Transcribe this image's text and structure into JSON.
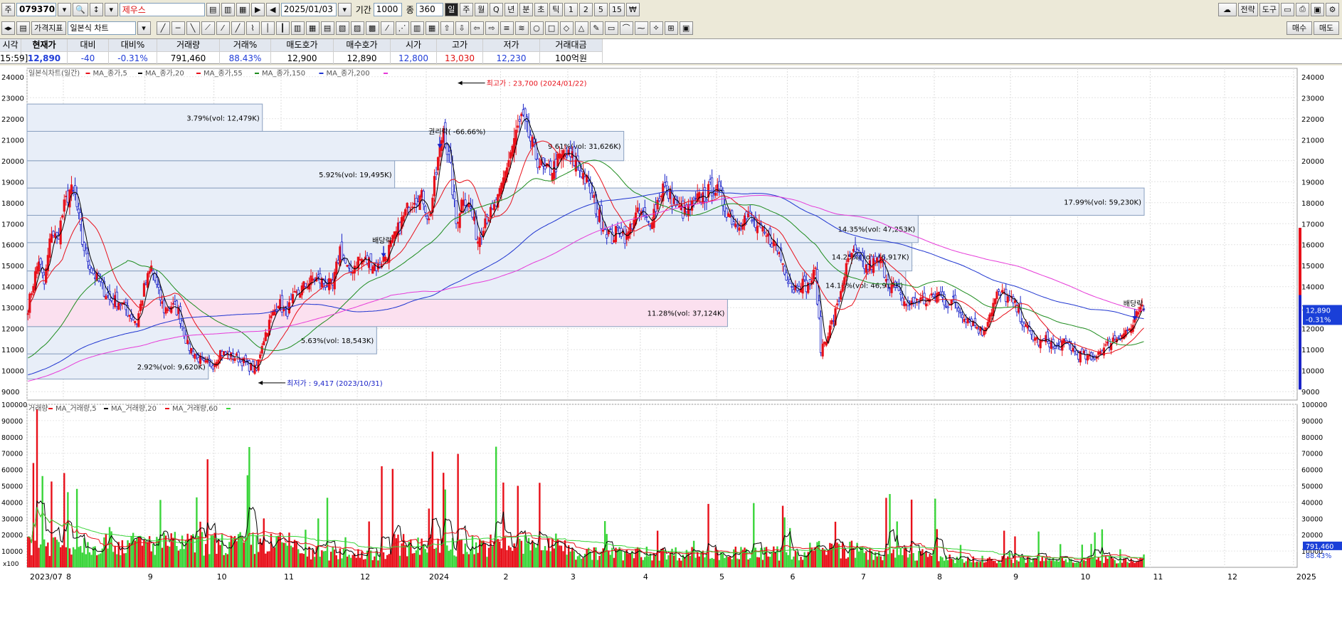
{
  "toolbar": {
    "code_prefix": "주",
    "stock_code": "079370",
    "stock_name": "제우스",
    "date": "2025/01/03",
    "period_label": "기간",
    "period_value": "1000",
    "count_label": "종",
    "count_value": "360",
    "periods": [
      "일",
      "주",
      "월",
      "Q",
      "년",
      "분",
      "초",
      "틱",
      "1",
      "2",
      "5",
      "15",
      "₩"
    ],
    "active_period": "일",
    "right_buttons": [
      "전략",
      "도구"
    ],
    "indicator_label": "가격지표",
    "chart_type": "일본식 차트",
    "buy_label": "매수",
    "sell_label": "매도"
  },
  "quote": {
    "headers": [
      "시각",
      "현재가",
      "대비",
      "대비%",
      "거래량",
      "거래%",
      "매도호가",
      "매수호가",
      "시가",
      "고가",
      "저가",
      "거래대금"
    ],
    "values": [
      "15:59]",
      "12,890",
      "-40",
      "-0.31%",
      "791,460",
      "88.43%",
      "12,900",
      "12,890",
      "12,800",
      "13,030",
      "12,230",
      "100억원"
    ]
  },
  "colors": {
    "up": "#e8101a",
    "down": "#1a23c8",
    "ma5": "#000000",
    "ma20": "#e8101a",
    "ma55": "#1e8c1e",
    "ma150": "#1f35d0",
    "ma200": "#e63ad8",
    "vol_up": "#e8101a",
    "vol_down": "#3ad53a",
    "profile_blue": "#e8eef8",
    "profile_pink": "#fbe0ef"
  },
  "chart_data": {
    "type": "candlestick",
    "legend": [
      {
        "name": "일본식차트(일간)",
        "color": "#e8101a"
      },
      {
        "name": "MA_종가,5",
        "color": "#000000"
      },
      {
        "name": "MA_종가,20",
        "color": "#e8101a"
      },
      {
        "name": "MA_종가,55",
        "color": "#1e8c1e"
      },
      {
        "name": "MA_종가,150",
        "color": "#1f35d0"
      },
      {
        "name": "MA_종가,200",
        "color": "#e63ad8"
      }
    ],
    "volume_legend": [
      {
        "name": "거래량",
        "color": "#e8101a"
      },
      {
        "name": "MA_거래량,5",
        "color": "#000000"
      },
      {
        "name": "MA_거래량,20",
        "color": "#e8101a"
      },
      {
        "name": "MA_거래량,60",
        "color": "#3ad53a"
      }
    ],
    "ylim": [
      8600,
      24400
    ],
    "yticks": [
      9000,
      10000,
      11000,
      12000,
      13000,
      14000,
      15000,
      16000,
      17000,
      18000,
      19000,
      20000,
      21000,
      22000,
      23000,
      24000
    ],
    "vol_ylim": [
      0,
      100000
    ],
    "vol_yticks": [
      10000,
      20000,
      30000,
      40000,
      50000,
      60000,
      70000,
      80000,
      90000,
      100000
    ],
    "vol_unit": "x100",
    "x_ticks": [
      {
        "label": "2023/07",
        "bar": 0
      },
      {
        "label": "8",
        "bar": 20
      },
      {
        "label": "9",
        "bar": 65
      },
      {
        "label": "10",
        "bar": 103
      },
      {
        "label": "11",
        "bar": 140
      },
      {
        "label": "12",
        "bar": 182
      },
      {
        "label": "2024",
        "bar": 220
      },
      {
        "label": "2",
        "bar": 261
      },
      {
        "label": "3",
        "bar": 298
      },
      {
        "label": "4",
        "bar": 338
      },
      {
        "label": "5",
        "bar": 380
      },
      {
        "label": "6",
        "bar": 419
      },
      {
        "label": "7",
        "bar": 458
      },
      {
        "label": "8",
        "bar": 500
      },
      {
        "label": "9",
        "bar": 542
      },
      {
        "label": "10",
        "bar": 579
      },
      {
        "label": "11",
        "bar": 619
      },
      {
        "label": "12",
        "bar": 660
      },
      {
        "label": "2025",
        "bar": 698
      }
    ],
    "n_bars": 700,
    "close_anchors": [
      [
        0,
        13000
      ],
      [
        3,
        14200
      ],
      [
        6,
        15300
      ],
      [
        9,
        14100
      ],
      [
        13,
        16700
      ],
      [
        16,
        16200
      ],
      [
        20,
        17800
      ],
      [
        23,
        18600
      ],
      [
        26,
        18300
      ],
      [
        30,
        16100
      ],
      [
        35,
        14800
      ],
      [
        40,
        14100
      ],
      [
        45,
        13400
      ],
      [
        50,
        13300
      ],
      [
        55,
        12800
      ],
      [
        60,
        12300
      ],
      [
        64,
        13900
      ],
      [
        68,
        14900
      ],
      [
        72,
        13700
      ],
      [
        75,
        12900
      ],
      [
        79,
        13100
      ],
      [
        83,
        12800
      ],
      [
        88,
        11200
      ],
      [
        92,
        10800
      ],
      [
        97,
        10300
      ],
      [
        102,
        10300
      ],
      [
        106,
        10900
      ],
      [
        110,
        10700
      ],
      [
        116,
        10600
      ],
      [
        122,
        10200
      ],
      [
        126,
        10000
      ],
      [
        129,
        11300
      ],
      [
        134,
        12500
      ],
      [
        138,
        13300
      ],
      [
        142,
        12700
      ],
      [
        147,
        13500
      ],
      [
        152,
        14000
      ],
      [
        158,
        14400
      ],
      [
        163,
        14200
      ],
      [
        168,
        14000
      ],
      [
        172,
        15800
      ],
      [
        177,
        14600
      ],
      [
        182,
        15300
      ],
      [
        188,
        15200
      ],
      [
        193,
        14900
      ],
      [
        198,
        15600
      ],
      [
        203,
        16500
      ],
      [
        208,
        17500
      ],
      [
        213,
        18300
      ],
      [
        218,
        18200
      ],
      [
        221,
        17100
      ],
      [
        226,
        20000
      ],
      [
        229,
        21600
      ],
      [
        233,
        19500
      ],
      [
        236,
        17000
      ],
      [
        240,
        18400
      ],
      [
        244,
        17700
      ],
      [
        248,
        16200
      ],
      [
        252,
        17300
      ],
      [
        256,
        17500
      ],
      [
        260,
        18300
      ],
      [
        264,
        19800
      ],
      [
        268,
        21000
      ],
      [
        272,
        22000
      ],
      [
        276,
        21200
      ],
      [
        280,
        20200
      ],
      [
        285,
        19400
      ],
      [
        290,
        19700
      ],
      [
        295,
        20300
      ],
      [
        300,
        20100
      ],
      [
        305,
        19500
      ],
      [
        310,
        18600
      ],
      [
        314,
        17500
      ],
      [
        318,
        16800
      ],
      [
        322,
        16300
      ],
      [
        326,
        16800
      ],
      [
        330,
        16300
      ],
      [
        334,
        17300
      ],
      [
        338,
        17500
      ],
      [
        342,
        17000
      ],
      [
        346,
        17800
      ],
      [
        350,
        18800
      ],
      [
        354,
        18300
      ],
      [
        358,
        17800
      ],
      [
        362,
        17500
      ],
      [
        366,
        17800
      ],
      [
        370,
        18200
      ],
      [
        374,
        18400
      ],
      [
        378,
        18800
      ],
      [
        382,
        18200
      ],
      [
        386,
        17500
      ],
      [
        390,
        17000
      ],
      [
        394,
        17300
      ],
      [
        398,
        17200
      ],
      [
        402,
        16800
      ],
      [
        406,
        16400
      ],
      [
        410,
        16200
      ],
      [
        414,
        15600
      ],
      [
        418,
        14600
      ],
      [
        422,
        13900
      ],
      [
        426,
        14200
      ],
      [
        430,
        14000
      ],
      [
        434,
        14700
      ],
      [
        437,
        11000
      ],
      [
        442,
        12000
      ],
      [
        446,
        13000
      ],
      [
        450,
        14600
      ],
      [
        454,
        15600
      ],
      [
        458,
        15300
      ],
      [
        462,
        14900
      ],
      [
        466,
        15100
      ],
      [
        470,
        15200
      ],
      [
        474,
        14300
      ],
      [
        478,
        13900
      ],
      [
        482,
        13300
      ],
      [
        486,
        13100
      ],
      [
        490,
        13400
      ],
      [
        494,
        13300
      ],
      [
        498,
        13400
      ],
      [
        502,
        13700
      ],
      [
        506,
        13200
      ],
      [
        510,
        13300
      ],
      [
        514,
        12800
      ],
      [
        518,
        12500
      ],
      [
        522,
        12200
      ],
      [
        526,
        11800
      ],
      [
        530,
        12700
      ],
      [
        534,
        13600
      ],
      [
        538,
        13600
      ],
      [
        542,
        13300
      ],
      [
        546,
        12800
      ],
      [
        550,
        12000
      ],
      [
        554,
        11600
      ],
      [
        558,
        11300
      ],
      [
        562,
        11500
      ],
      [
        566,
        11000
      ],
      [
        570,
        11300
      ],
      [
        574,
        11200
      ],
      [
        578,
        10800
      ],
      [
        582,
        10700
      ],
      [
        586,
        10500
      ],
      [
        590,
        10900
      ],
      [
        594,
        11100
      ],
      [
        598,
        11500
      ],
      [
        602,
        11700
      ],
      [
        606,
        11900
      ],
      [
        609,
        12100
      ],
      [
        612,
        12800
      ],
      [
        615,
        12890
      ]
    ],
    "annotations": [
      {
        "text": "최고가 : 23,700 (2024/01/22)",
        "color": "#e8101a",
        "bar": 237,
        "value": 23700
      },
      {
        "text": "최저가 : 9,417 (2023/10/31)",
        "color": "#1a23c8",
        "bar": 127,
        "value": 9417
      },
      {
        "text": "권리락( -66.66%)",
        "color": "#000000",
        "bar": 227,
        "value": 21000
      },
      {
        "text": "배당락",
        "color": "#000000",
        "bar": 196,
        "value": 15800
      },
      {
        "text": "배당락",
        "color": "#000000",
        "bar": 610,
        "value": 12800
      }
    ],
    "volume_profile": [
      {
        "lo": 9600,
        "hi": 10800,
        "label": "2.92%(vol: 9,620K)",
        "pink": false
      },
      {
        "lo": 10800,
        "hi": 12100,
        "label": "5.63%(vol: 18,543K)",
        "pink": false
      },
      {
        "lo": 12100,
        "hi": 13400,
        "label": "11.28%(vol: 37,124K)",
        "pink": true
      },
      {
        "lo": 13400,
        "hi": 14750,
        "label": "14.15%(vol: 46,918K)",
        "pink": false
      },
      {
        "lo": 14750,
        "hi": 16100,
        "label": "14.25%(vol: 46,917K)",
        "pink": false
      },
      {
        "lo": 16100,
        "hi": 17400,
        "label": "14.35%(vol: 47,253K)",
        "pink": false
      },
      {
        "lo": 17400,
        "hi": 18700,
        "label": "17.99%(vol: 59,230K)",
        "pink": false
      },
      {
        "lo": 18700,
        "hi": 20000,
        "label": "5.92%(vol: 19,495K)",
        "pink": false
      },
      {
        "lo": 20000,
        "hi": 21400,
        "label": "9.61%(vol: 31,626K)",
        "pink": false
      },
      {
        "lo": 21400,
        "hi": 22700,
        "label": "3.79%(vol: 12,479K)",
        "pink": false
      }
    ],
    "current": {
      "price": "12,890",
      "change": "-0.31%",
      "volume": "791,460",
      "vol_pct": "88.43%"
    }
  }
}
